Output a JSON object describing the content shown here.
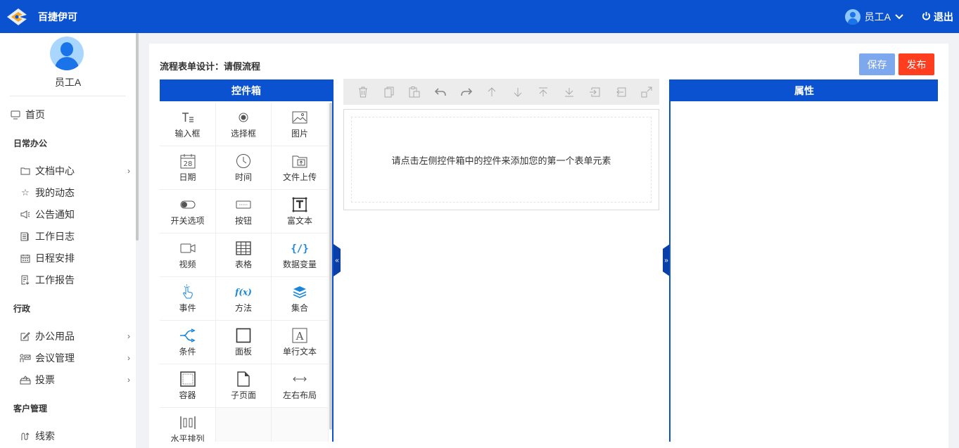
{
  "header": {
    "app_title": "百捷伊可",
    "user_name": "员工A",
    "logout_label": "退出",
    "brand_color": "#0b52d1"
  },
  "sidebar": {
    "user_name": "员工A",
    "home": "首页",
    "groups": [
      {
        "label": "日常办公"
      },
      {
        "label": "行政"
      },
      {
        "label": "客户管理"
      }
    ],
    "items": [
      {
        "label": "文档中心",
        "icon": "folder-icon"
      },
      {
        "label": "我的动态",
        "icon": "star-icon"
      },
      {
        "label": "公告通知",
        "icon": "megaphone-icon"
      },
      {
        "label": "工作日志",
        "icon": "journal-icon"
      },
      {
        "label": "日程安排",
        "icon": "calendar-icon"
      },
      {
        "label": "工作报告",
        "icon": "report-icon"
      },
      {
        "label": "办公用品",
        "icon": "edit-icon"
      },
      {
        "label": "会议管理",
        "icon": "meeting-icon"
      },
      {
        "label": "投票",
        "icon": "vote-icon"
      },
      {
        "label": "线索",
        "icon": "clue-icon"
      }
    ]
  },
  "page": {
    "title": "流程表单设计：请假流程",
    "save_label": "保存",
    "publish_label": "发布",
    "save_color": "#7ea8ee",
    "publish_color": "#ff3d1f"
  },
  "controls": {
    "header": "控件箱",
    "items": [
      {
        "label": "输入框",
        "icon": "text-input-icon"
      },
      {
        "label": "选择框",
        "icon": "radio-icon"
      },
      {
        "label": "图片",
        "icon": "image-icon"
      },
      {
        "label": "日期",
        "icon": "calendar-date-icon"
      },
      {
        "label": "时间",
        "icon": "clock-icon"
      },
      {
        "label": "文件上传",
        "icon": "folder-upload-icon"
      },
      {
        "label": "开关选项",
        "icon": "toggle-icon"
      },
      {
        "label": "按钮",
        "icon": "button-icon"
      },
      {
        "label": "富文本",
        "icon": "rich-text-icon"
      },
      {
        "label": "视频",
        "icon": "video-icon"
      },
      {
        "label": "表格",
        "icon": "table-icon"
      },
      {
        "label": "数据变量",
        "icon": "variable-icon"
      },
      {
        "label": "事件",
        "icon": "pointer-icon"
      },
      {
        "label": "方法",
        "icon": "function-icon"
      },
      {
        "label": "集合",
        "icon": "layers-icon"
      },
      {
        "label": "条件",
        "icon": "branch-icon"
      },
      {
        "label": "面板",
        "icon": "panel-icon"
      },
      {
        "label": "单行文本",
        "icon": "single-text-icon"
      },
      {
        "label": "容器",
        "icon": "container-icon"
      },
      {
        "label": "子页面",
        "icon": "subpage-icon"
      },
      {
        "label": "左右布局",
        "icon": "horizontal-arrows-icon"
      },
      {
        "label": "水平排列",
        "icon": "horizontal-align-icon"
      }
    ]
  },
  "toolbar": {
    "buttons": [
      "delete-icon",
      "copy-icon",
      "paste-icon",
      "undo-icon",
      "redo-icon",
      "move-up-icon",
      "move-down-icon",
      "move-top-icon",
      "move-bottom-icon",
      "insert-icon",
      "extract-icon",
      "expand-icon"
    ]
  },
  "canvas": {
    "placeholder": "请点击左侧控件箱中的控件来添加您的第一个表单元素"
  },
  "properties": {
    "header": "属性"
  }
}
